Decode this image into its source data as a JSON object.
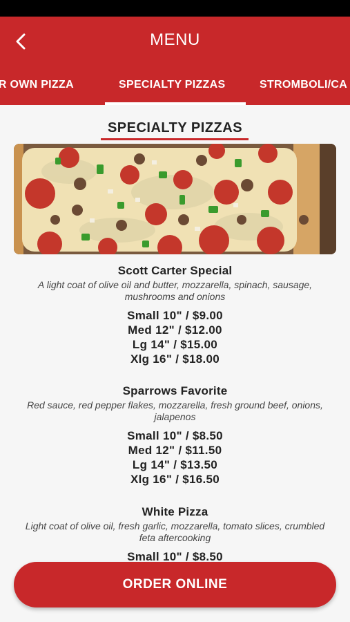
{
  "header": {
    "title": "MENU",
    "back_icon": "chevron-left-icon"
  },
  "tabs": [
    {
      "label": "UR OWN PIZZA"
    },
    {
      "label": "SPECIALTY PIZZAS",
      "active": true
    },
    {
      "label": "STROMBOLI/CA"
    }
  ],
  "section": {
    "title": "SPECIALTY PIZZAS"
  },
  "image": {
    "subject": "pizza-photo"
  },
  "items": [
    {
      "name": "Scott Carter Special",
      "description": "A light coat of olive oil and butter, mozzarella, spinach, sausage, mushrooms and onions",
      "prices": [
        "Small 10\" / $9.00",
        "Med 12\" / $12.00",
        "Lg 14\" / $15.00",
        "Xlg 16\" / $18.00"
      ]
    },
    {
      "name": "Sparrows Favorite",
      "description": "Red sauce, red pepper flakes, mozzarella, fresh ground beef, onions, jalapenos",
      "prices": [
        "Small 10\" / $8.50",
        "Med 12\" / $11.50",
        "Lg 14\" / $13.50",
        "Xlg 16\" / $16.50"
      ]
    },
    {
      "name": "White Pizza",
      "description": "Light coat of olive oil, fresh garlic, mozzarella, tomato slices, crumbled feta aftercooking",
      "prices": [
        "Small 10\" / $8.50"
      ]
    }
  ],
  "order_button": {
    "label": "ORDER ONLINE"
  },
  "colors": {
    "brand_red": "#c8282a",
    "background": "#f6f6f6",
    "text": "#222222"
  }
}
